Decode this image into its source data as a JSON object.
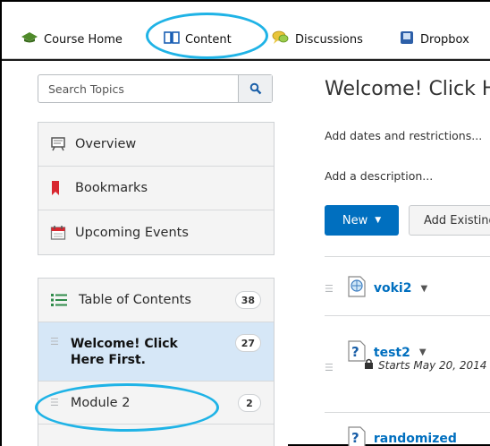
{
  "topnav": {
    "items": [
      {
        "label": "Course Home",
        "icon": "course-home-icon"
      },
      {
        "label": "Content",
        "icon": "content-book-icon"
      },
      {
        "label": "Discussions",
        "icon": "discussions-icon"
      },
      {
        "label": "Dropbox",
        "icon": "dropbox-icon"
      }
    ]
  },
  "search": {
    "placeholder": "Search Topics"
  },
  "nav": {
    "items": [
      {
        "label": "Overview",
        "icon": "overview-icon"
      },
      {
        "label": "Bookmarks",
        "icon": "bookmark-icon"
      },
      {
        "label": "Upcoming Events",
        "icon": "calendar-icon"
      }
    ]
  },
  "toc": {
    "header": {
      "label": "Table of Contents",
      "count": "38"
    },
    "modules": [
      {
        "label": "Welcome! Click Here First.",
        "count": "27",
        "selected": true
      },
      {
        "label": "Module 2",
        "count": "2",
        "selected": false
      }
    ]
  },
  "main": {
    "title": "Welcome! Click Here First.",
    "add_dates": "Add dates and restrictions...",
    "add_description": "Add a description...",
    "new_button": "New",
    "add_existing_button": "Add Existing Activities",
    "items": [
      {
        "name": "voki2",
        "icon": "web-link-icon"
      },
      {
        "name": "test2",
        "icon": "quiz-icon",
        "detail": "Starts May 20, 2014"
      },
      {
        "name": "randomized",
        "icon": "quiz-icon"
      }
    ]
  },
  "colors": {
    "accent": "#006fbf",
    "highlight_oval": "#1fb3e6",
    "selected_row": "#d6e7f7"
  }
}
